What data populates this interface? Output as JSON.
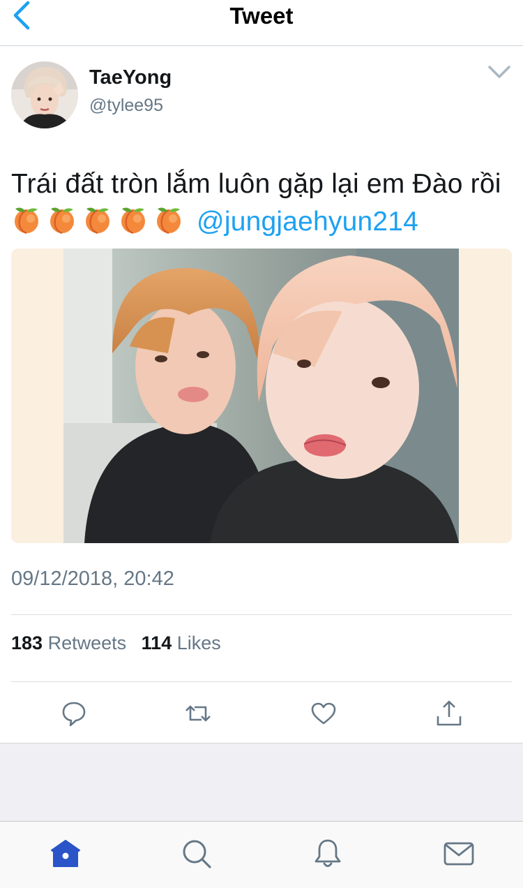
{
  "navbar": {
    "title": "Tweet",
    "back_icon": "chevron-left-icon"
  },
  "author": {
    "display_name": "TaeYong",
    "handle": "@tylee95",
    "menu_icon": "chevron-down-icon"
  },
  "tweet": {
    "text": "Trái đất tròn lắm luôn gặp lại em Đào rồi",
    "emoji": [
      "🍑",
      "🍑",
      "🍑",
      "🍑",
      "🍑"
    ],
    "mention": "@jungjaehyun214",
    "timestamp": "09/12/2018, 20:42"
  },
  "stats": {
    "retweets_count": "183",
    "retweets_label": "Retweets",
    "likes_count": "114",
    "likes_label": "Likes"
  },
  "actions": [
    "reply-icon",
    "retweet-icon",
    "like-icon",
    "share-icon"
  ],
  "tabbar": [
    "home-icon",
    "search-icon",
    "notifications-icon",
    "messages-icon"
  ],
  "colors": {
    "accent": "#1da1f2",
    "secondary_text": "#657786",
    "primary_text": "#14171a",
    "media_bg": "#fbefe0",
    "tab_active": "#2a54c7"
  }
}
